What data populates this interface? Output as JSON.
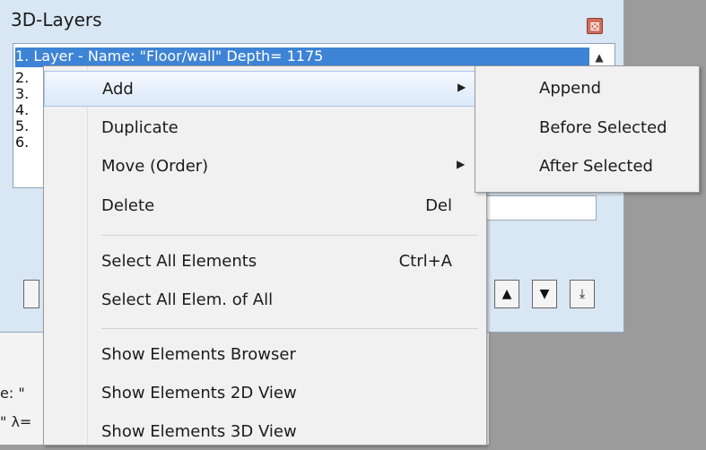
{
  "palette": {
    "title": "3D-Layers",
    "close_symbol": "⊠",
    "list_rows": [
      "1. Layer - Name: \"Floor/wall\" Depth= 1175",
      "2.",
      "3.",
      "4.",
      "5.",
      "6."
    ]
  },
  "background": {
    "lines": [
      "e: \"",
      "\" λ="
    ]
  },
  "context_menu": {
    "items": [
      {
        "label": "Add",
        "submenu": true
      },
      {
        "label": "Duplicate"
      },
      {
        "label": "Move (Order)",
        "submenu": true
      },
      {
        "label": "Delete",
        "shortcut": "Del"
      },
      {
        "label": "Select All Elements",
        "shortcut": "Ctrl+A"
      },
      {
        "label": "Select All Elem. of All"
      },
      {
        "label": "Show Elements Browser"
      },
      {
        "label": "Show Elements 2D View"
      },
      {
        "label": "Show Elements 3D View"
      }
    ]
  },
  "submenu": {
    "items": [
      "Append",
      "Before Selected",
      "After Selected"
    ]
  },
  "icons": {
    "submenu_arrow": "▶",
    "move_up": "▲",
    "move_down": "▼",
    "move_bottom": "⤓"
  }
}
